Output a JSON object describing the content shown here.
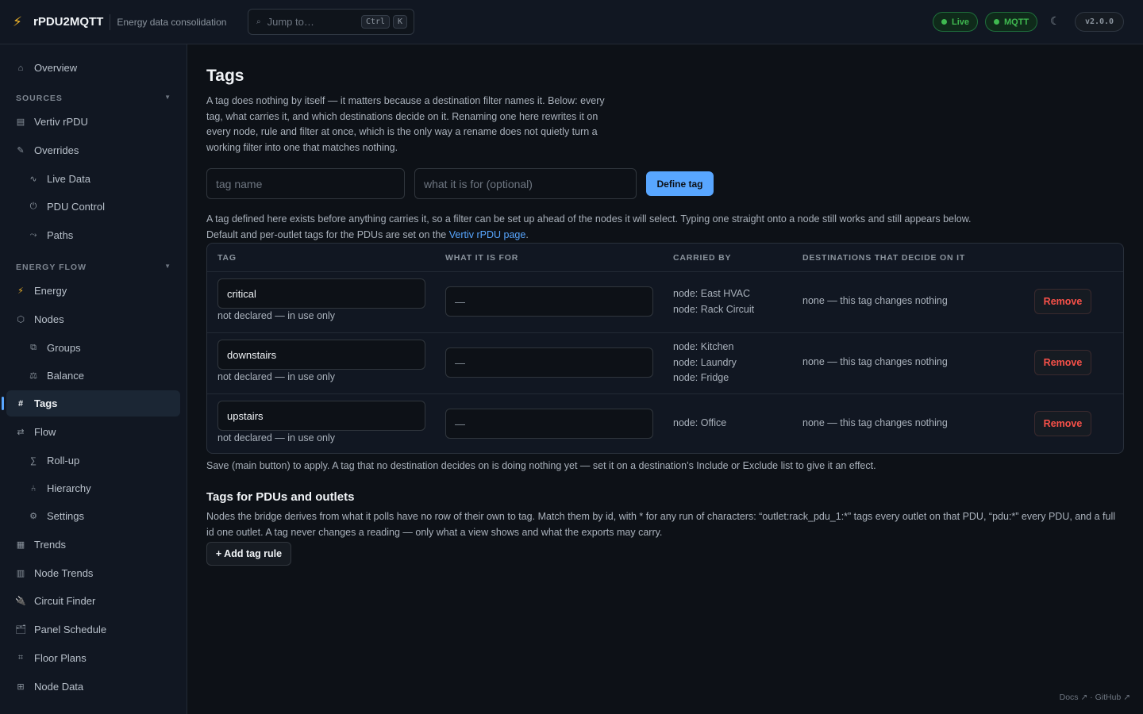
{
  "header": {
    "app_name": "rPDU2MQTT",
    "subtitle": "Energy data consolidation",
    "search_placeholder": "Jump to…",
    "kbd_ctrl": "Ctrl",
    "kbd_k": "K",
    "status_live": "Live",
    "status_mqtt": "MQTT",
    "theme_icon": "☾",
    "version": "v2.0.0"
  },
  "sidebar": {
    "overview": "Overview",
    "sources_label": "SOURCES",
    "vertiv": "Vertiv rPDU",
    "overrides": "Overrides",
    "live_data": "Live Data",
    "pdu_control": "PDU Control",
    "paths": "Paths",
    "energy_flow_label": "ENERGY FLOW",
    "energy": "Energy",
    "nodes": "Nodes",
    "groups": "Groups",
    "balance": "Balance",
    "tags": "Tags",
    "flow": "Flow",
    "rollup": "Roll-up",
    "hierarchy": "Hierarchy",
    "settings": "Settings",
    "trends": "Trends",
    "node_trends": "Node Trends",
    "circuit_finder": "Circuit Finder",
    "panel_schedule": "Panel Schedule",
    "floor_plans": "Floor Plans",
    "node_data": "Node Data"
  },
  "main": {
    "title": "Tags",
    "intro": "A tag does nothing by itself — it matters because a destination filter names it. Below: every tag, what carries it, and which destinations decide on it. Renaming one here rewrites it on every node, rule and filter at once, which is the only way a rename does not quietly turn a working filter into one that matches nothing.",
    "tag_name_placeholder": "tag name",
    "tag_desc_placeholder": "what it is for (optional)",
    "define_button": "Define tag",
    "note_line1": "A tag defined here exists before anything carries it, so a filter can be set up ahead of the nodes it will select. Typing one straight onto a node still works and still appears below.",
    "note_line2_prefix": "Default and per-outlet tags for the PDUs are set on the ",
    "note_line2_link": "Vertiv rPDU page",
    "note_line2_suffix": ".",
    "table_headers": {
      "tag": "TAG",
      "purpose": "WHAT IT IS FOR",
      "carried": "CARRIED BY",
      "destinations": "DESTINATIONS THAT DECIDE ON IT"
    },
    "rows": [
      {
        "tag": "critical",
        "status": "not declared — in use only",
        "purpose": "—",
        "carried_1": "node: East HVAC",
        "carried_2": "node: Rack Circuit",
        "carried_3": "",
        "destinations": "none — this tag changes nothing",
        "remove": "Remove"
      },
      {
        "tag": "downstairs",
        "status": "not declared — in use only",
        "purpose": "—",
        "carried_1": "node: Kitchen",
        "carried_2": "node: Laundry",
        "carried_3": "node: Fridge",
        "destinations": "none — this tag changes nothing",
        "remove": "Remove"
      },
      {
        "tag": "upstairs",
        "status": "not declared — in use only",
        "purpose": "—",
        "carried_1": "node: Office",
        "carried_2": "",
        "carried_3": "",
        "destinations": "none — this tag changes nothing",
        "remove": "Remove"
      }
    ],
    "save_note": "Save (main button) to apply. A tag that no destination decides on is doing nothing yet — set it on a destination’s Include or Exclude list to give it an effect.",
    "pdu_title": "Tags for PDUs and outlets",
    "pdu_note": "Nodes the bridge derives from what it polls have no row of their own to tag. Match them by id, with * for any run of characters: “outlet:rack_pdu_1:*” tags every outlet on that PDU, “pdu:*” every PDU, and a full id one outlet. A tag never changes a reading — only what a view shows and what the exports may carry.",
    "add_rule_button": "+ Add tag rule"
  },
  "footer": {
    "links": "Docs ↗ · GitHub ↗"
  },
  "colors": {
    "accent": "#58a6ff",
    "live": "#3fb950",
    "danger": "#f85149"
  }
}
